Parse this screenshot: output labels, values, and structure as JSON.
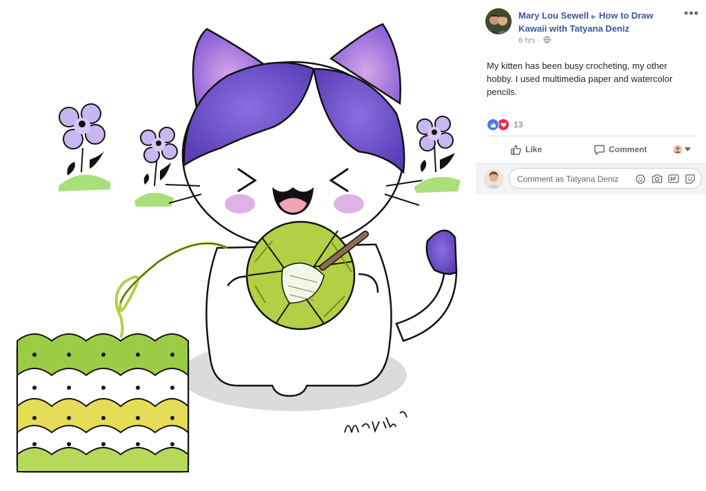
{
  "post": {
    "author": "Mary Lou Sewell",
    "group": "How to Draw Kawaii with Tatyana Deniz",
    "time": "6 hrs",
    "audience_icon": "globe-icon",
    "more_label": "•••",
    "text": "My kitten has been busy crocheting, my other hobby. I used multimedia paper and watercolor pencils."
  },
  "reactions": {
    "icons": [
      "like-icon",
      "love-icon"
    ],
    "count": "13"
  },
  "actions": {
    "like": "Like",
    "comment": "Comment"
  },
  "comment_box": {
    "placeholder": "Comment as Tatyana Deniz",
    "icons": [
      "emoji-icon",
      "camera-icon",
      "gif-icon",
      "sticker-icon"
    ]
  },
  "artwork": {
    "signature": "Mary Lou"
  },
  "colors": {
    "link": "#385898",
    "like_blue": "#4a78e8",
    "love_red": "#f0284a",
    "purple_paint": "#6b4fc4",
    "yarn_green": "#b3cf45"
  }
}
